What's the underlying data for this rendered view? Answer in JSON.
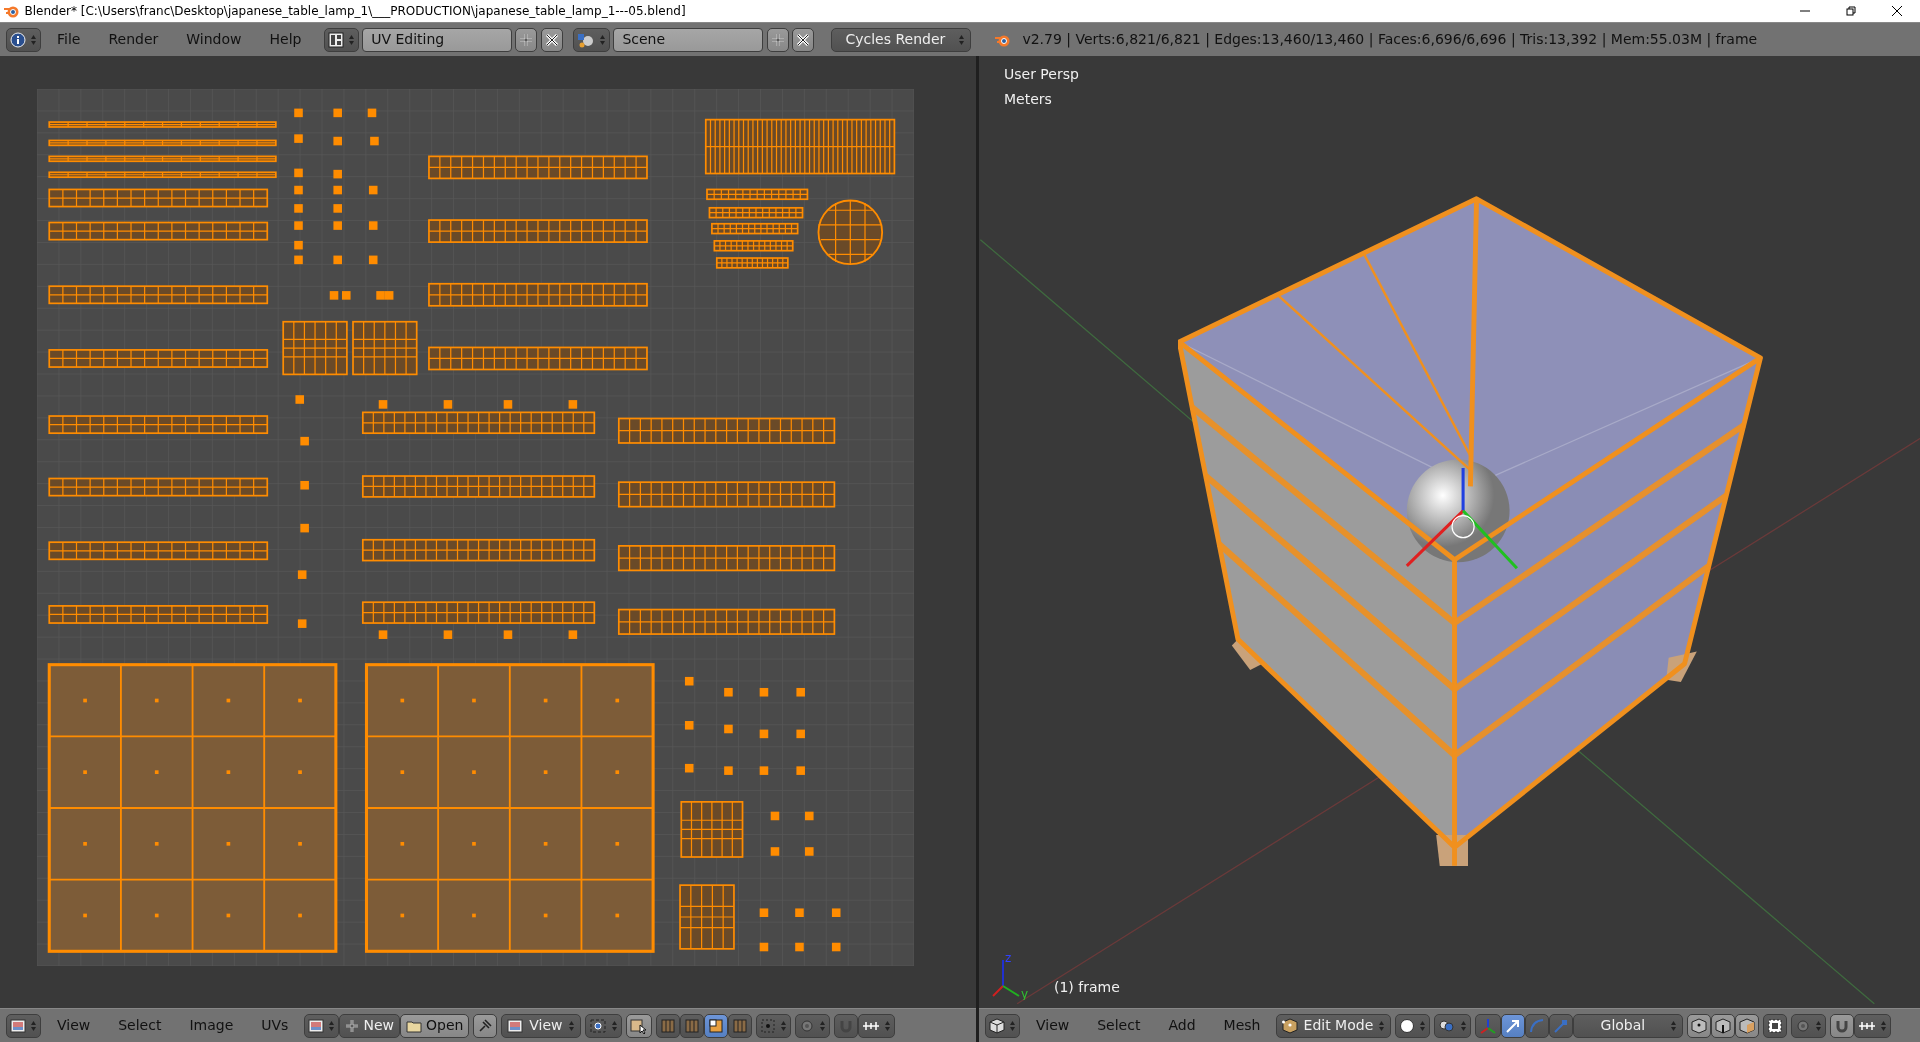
{
  "window": {
    "title": "Blender* [C:\\Users\\franc\\Desktop\\japanese_table_lamp_1\\___PRODUCTION\\japanese_table_lamp_1---05.blend]"
  },
  "info_header": {
    "menus": [
      "File",
      "Render",
      "Window",
      "Help"
    ],
    "screen_layout": "UV Editing",
    "scene": "Scene",
    "render_engine": "Cycles Render",
    "stats": "v2.79 | Verts:6,821/6,821 | Edges:13,460/13,460 | Faces:6,696/6,696 | Tris:13,392 | Mem:55.03M | frame"
  },
  "uv_editor": {
    "menus": [
      "View",
      "Select",
      "Image",
      "UVs"
    ],
    "new_button": "New",
    "open_button": "Open",
    "view_dropdown": "View",
    "select_modes": [
      {
        "selected": false
      },
      {
        "selected": false
      },
      {
        "selected": true
      },
      {
        "selected": false
      }
    ]
  },
  "viewport": {
    "overlay_lines": [
      "User Persp",
      "Meters"
    ],
    "axis_labels": [
      "z",
      "y"
    ],
    "frame_label": "(1) frame",
    "menus": [
      "View",
      "Select",
      "Add",
      "Mesh"
    ],
    "mode": "Edit Mode",
    "orientation": "Global",
    "manipulators": [
      {
        "selected": true
      },
      {
        "selected": false
      },
      {
        "selected": false
      }
    ]
  }
}
